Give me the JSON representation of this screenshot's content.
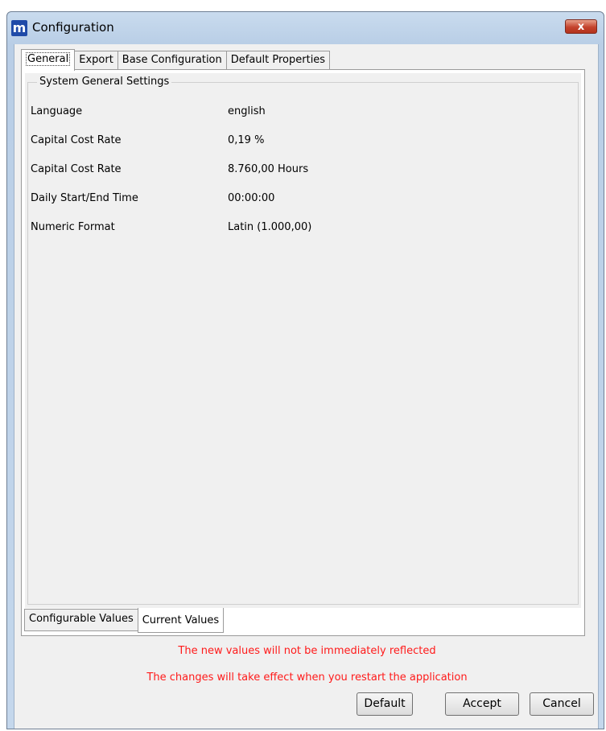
{
  "window": {
    "title": "Configuration",
    "close_label": "x"
  },
  "tabs": [
    {
      "label": "General"
    },
    {
      "label": "Export"
    },
    {
      "label": "Base Configuration"
    },
    {
      "label": "Default Properties"
    }
  ],
  "group": {
    "title": "System General Settings",
    "rows": [
      {
        "label": "Language",
        "value": "english"
      },
      {
        "label": "Capital Cost Rate",
        "value": "0,19 %"
      },
      {
        "label": "Capital Cost Rate",
        "value": "8.760,00 Hours"
      },
      {
        "label": "Daily Start/End Time",
        "value": "00:00:00"
      },
      {
        "label": "Numeric Format",
        "value": "Latin (1.000,00)"
      }
    ]
  },
  "bottom_tabs": [
    {
      "label": "Configurable Values"
    },
    {
      "label": "Current Values"
    }
  ],
  "messages": {
    "line1": "The new values will not be immediately reflected",
    "line2": "The changes will take effect when you restart the application"
  },
  "buttons": {
    "default": "Default",
    "accept": "Accept",
    "cancel": "Cancel"
  },
  "colors": {
    "message": "#ff1a1a",
    "app_icon": "#1f4aa8"
  }
}
